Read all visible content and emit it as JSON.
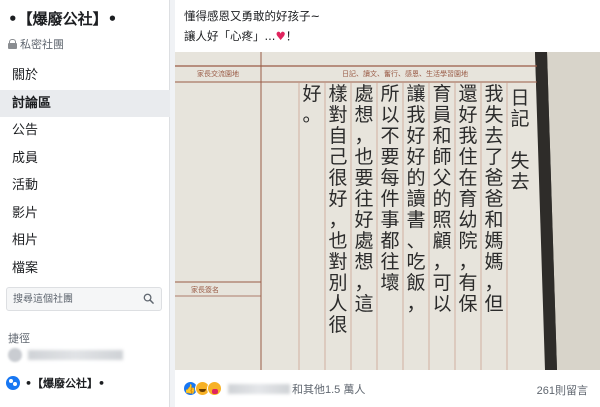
{
  "sidebar": {
    "group_name": "•【爆廢公社】•",
    "privacy": "私密社團",
    "nav": [
      {
        "label": "關於",
        "active": false
      },
      {
        "label": "討論區",
        "active": true
      },
      {
        "label": "公告",
        "active": false
      },
      {
        "label": "成員",
        "active": false
      },
      {
        "label": "活動",
        "active": false
      },
      {
        "label": "影片",
        "active": false
      },
      {
        "label": "相片",
        "active": false
      },
      {
        "label": "檔案",
        "active": false
      }
    ],
    "search_placeholder": "搜尋這個社團",
    "shortcuts_heading": "捷徑",
    "shortcut_group": "•【爆廢公社】•"
  },
  "post": {
    "caption_line1": "懂得感恩又勇敢的好孩子~",
    "caption_line2_prefix": "讓人好「心疼」...",
    "caption_heart": "♥",
    "caption_line2_suffix": "！",
    "photo": {
      "header_left": "家長交流園地",
      "header_right": "日記、讀文、奮行、感恩、生活學習園地",
      "footer_left": "家長簽名",
      "columns": [
        "日記 失去",
        "我失去了爸爸和媽媽，但",
        "還好我住在育幼院，有保",
        "育員和師父的照顧，可以",
        "讓我好好的讀書、吃飯，",
        "所以不要每件事都往壞",
        "處想，也要往好處想，這",
        "樣對自己很好，也對別人很",
        "好。"
      ]
    },
    "reactions": {
      "like_icon": "like-icon",
      "count_text": "和其他1.5 萬人",
      "comments_text": "261則留言"
    }
  }
}
